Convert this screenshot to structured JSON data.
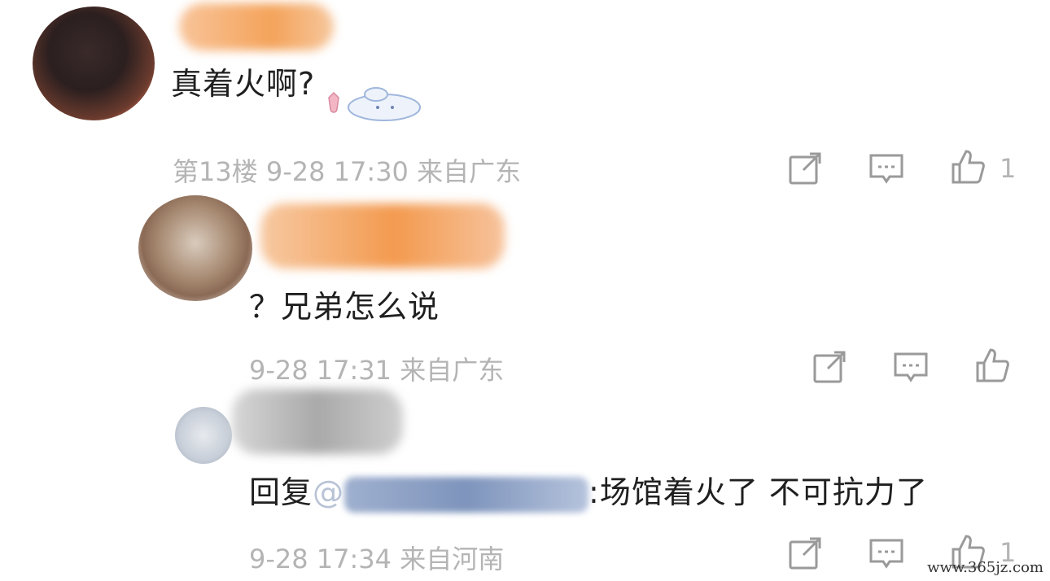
{
  "comments": [
    {
      "text": "真着火啊?",
      "meta": "第13楼 9-28 17:30 来自广东",
      "like_count": "1"
    },
    {
      "text": "？兄弟怎么说",
      "meta": "9-28 17:31 来自广东",
      "like_count": ""
    },
    {
      "reply_prefix": "回复",
      "reply_at": "@",
      "text": ":场馆着火了 不可抗力了",
      "meta": "9-28 17:34 来自河南",
      "like_count": "1"
    }
  ],
  "icons": {
    "share": "share-icon",
    "comment": "comment-icon",
    "like": "thumbs-up-icon",
    "emoji": "sticker-icon"
  },
  "colors": {
    "meta_gray": "#b4b4b4",
    "text": "#1f1f1f",
    "redaction_orange": "#f4a35a",
    "redaction_blue": "#8da1c4"
  },
  "watermark": "www.365jz.com"
}
